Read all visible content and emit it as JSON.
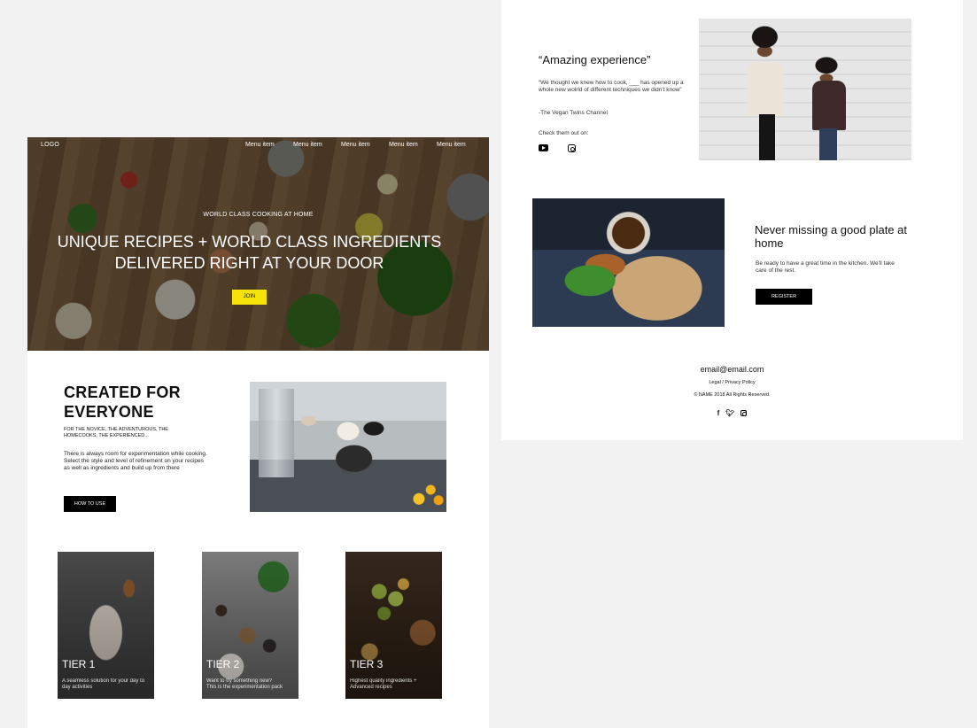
{
  "colors": {
    "background": "#f2f2f2",
    "page": "#ffffff",
    "accent_yellow": "#f5e30a",
    "button_black": "#000000"
  },
  "home": {
    "header": {
      "logo": "LOGO",
      "nav": [
        "Menu item",
        "Menu item",
        "Menu item",
        "Menu item",
        "Menu item"
      ]
    },
    "hero": {
      "eyebrow": "WORLD CLASS COOKING AT HOME",
      "headline_line1": "UNIQUE RECIPES + WORLD CLASS INGREDIENTS",
      "headline_line2": "DELIVERED RIGHT AT YOUR DOOR",
      "join_label": "JOIN"
    },
    "created": {
      "title_line1": "CREATED FOR",
      "title_line2": "EVERYONE",
      "subtitle": "FOR THE NOVICE, THE ADVENTUROUS, THE HOMECOOKS, THE EXPERIENCED...",
      "body": "There is always room for experimentation while cooking. Select the style and level of refinement on your recipes as well as ingredients and build up from there",
      "button_label": "HOW TO USE"
    },
    "tiers": [
      {
        "title": "TIER 1",
        "desc_line1": "A seamless solution for your day to",
        "desc_line2": "day activities"
      },
      {
        "title": "TIER 2",
        "desc_line1": "Want to try something new?",
        "desc_line2": "This is the experimentation pack"
      },
      {
        "title": "TIER 3",
        "desc_line1": "Highest quality ingredients +",
        "desc_line2": "Advanced recipes"
      }
    ]
  },
  "about": {
    "testimonial": {
      "title": "“Amazing experience”",
      "quote": "“We thought we knew how to cook, ___ has opened up a whole new wolrld of different techniques we didn't know”",
      "author": "-The Vegan Twins Channel",
      "check_label": "Check them out on:",
      "icons": [
        "youtube-icon",
        "instagram-icon"
      ]
    },
    "plate": {
      "title": "Never missing a good plate at home",
      "body": "Be ready to have a great time in the kitchen. We'll take care of the rest.",
      "button_label": "REGISTER"
    },
    "footer": {
      "email": "email@email.com",
      "legal": "Legal / Privacy Policy",
      "copyright": "© NAME 2018 All Rights Reserved.",
      "socials": [
        "facebook-icon",
        "twitter-icon",
        "instagram-icon"
      ]
    }
  }
}
